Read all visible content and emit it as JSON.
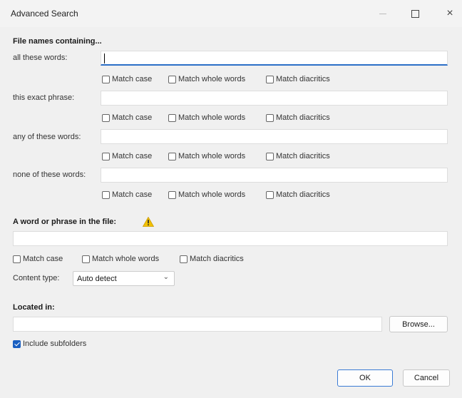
{
  "window": {
    "title": "Advanced Search",
    "close": "×"
  },
  "file_names": {
    "heading": "File names containing...",
    "rows": [
      {
        "label": "all these words:",
        "value": ""
      },
      {
        "label": "this exact phrase:",
        "value": ""
      },
      {
        "label": "any of these words:",
        "value": ""
      },
      {
        "label": "none of these words:",
        "value": ""
      }
    ],
    "options": [
      "Match case",
      "Match whole words",
      "Match diacritics"
    ]
  },
  "content": {
    "heading": "A word or phrase in the file:",
    "value": "",
    "warning_icon": "warning-icon",
    "options": [
      "Match case",
      "Match whole words",
      "Match diacritics"
    ],
    "content_type_label": "Content type:",
    "content_type_value": "Auto detect",
    "chevron": "⌄"
  },
  "location": {
    "heading": "Located in:",
    "value": "",
    "browse_label": "Browse...",
    "include_subfolders_label": "Include subfolders",
    "include_subfolders_checked": true
  },
  "buttons": {
    "ok": "OK",
    "cancel": "Cancel"
  },
  "colors": {
    "accent": "#1a5fc1",
    "focus": "#2b6fc7",
    "warning": "#f2c100"
  }
}
